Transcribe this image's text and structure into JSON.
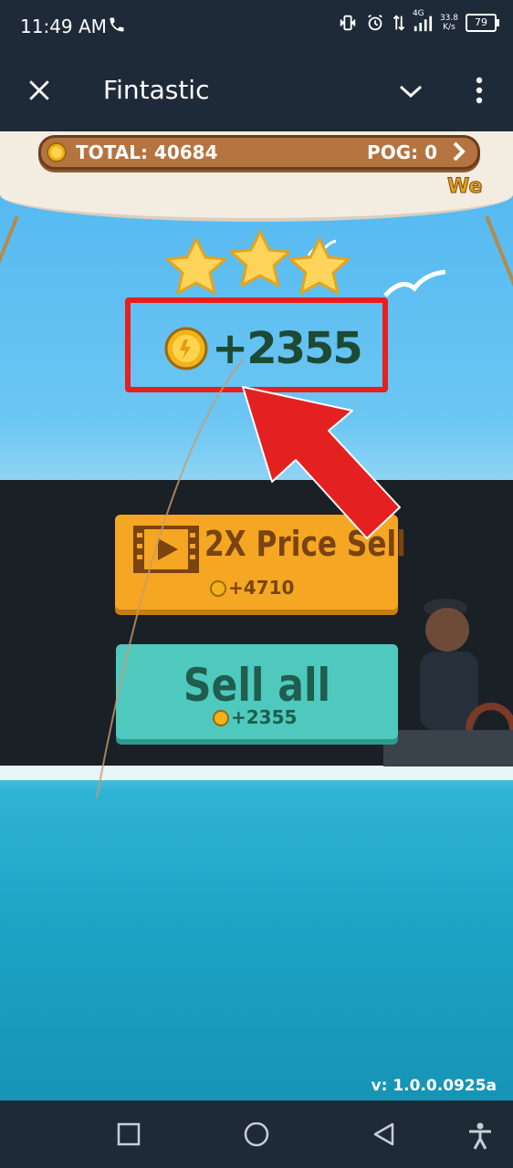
{
  "status_bar": {
    "time": "11:49 AM",
    "net_speed_top": "33.8",
    "net_speed_bottom": "K/s",
    "network": "4G",
    "battery": "79"
  },
  "app_bar": {
    "title": "Fintastic"
  },
  "game": {
    "total_label": "TOTAL: 40684",
    "pog_label": "POG: 0",
    "corner_text": "We",
    "stars": 3,
    "reward": "+2355",
    "btn_2x": {
      "label": "2X Price Sell",
      "amount": "+4710"
    },
    "btn_sell": {
      "label": "Sell all",
      "amount": "+2355"
    },
    "version": "v: 1.0.0.0925a"
  },
  "colors": {
    "highlight": "#e52020",
    "btn_2x": "#f5a623",
    "btn_sell": "#4fc9be"
  }
}
